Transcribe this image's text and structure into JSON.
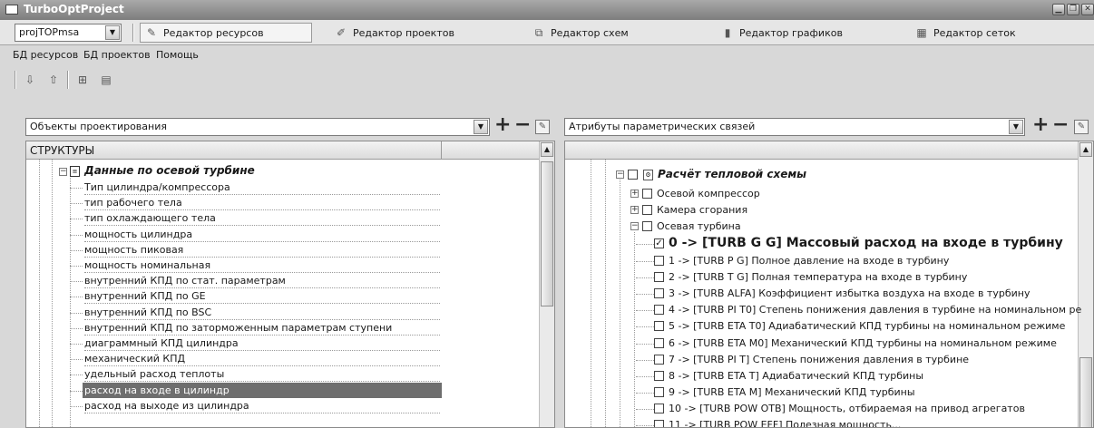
{
  "window": {
    "title": "TurboOptProject"
  },
  "toolbar": {
    "project_combo": "projTOPmsa",
    "tabs": [
      {
        "label": "Редактор ресурсов",
        "icon": "resource-editor-icon"
      },
      {
        "label": "Редактор проектов",
        "icon": "project-editor-icon"
      },
      {
        "label": "Редактор схем",
        "icon": "scheme-editor-icon"
      },
      {
        "label": "Редактор графиков",
        "icon": "chart-editor-icon"
      },
      {
        "label": "Редактор сеток",
        "icon": "grid-editor-icon"
      }
    ]
  },
  "menu": {
    "items": [
      "БД ресурсов",
      "БД проектов",
      "Помощь"
    ]
  },
  "left": {
    "combo": "Объекты проектирования",
    "header": "СТРУКТУРЫ",
    "group_title": "Данные по осевой турбине",
    "items": [
      "Тип цилиндра/компрессора",
      "тип рабочего тела",
      "тип охлаждающего тела",
      "мощность цилиндра",
      "мощность пиковая",
      "мощность номинальная",
      "внутренний КПД по стат. параметрам",
      "внутренний КПД по GE",
      "внутренний КПД по BSC",
      "внутренний КПД по заторможенным параметрам ступени",
      "диаграммный КПД цилиндра",
      "механический КПД",
      "удельный расход теплоты",
      "расход на входе в цилиндр",
      "расход на выходе из цилиндра"
    ],
    "selected_index": 13
  },
  "right": {
    "combo": "Атрибуты параметрических связей",
    "root_title": "Расчёт тепловой схемы",
    "groups": [
      "Осевой компрессор",
      "Камера сгорания",
      "Осевая турбина"
    ],
    "checked_item": "0 -> [TURB G G] Массовый расход на входе в турбину",
    "items": [
      "1 -> [TURB P G] Полное давление на входе в турбину",
      "2 -> [TURB T G] Полная температура на входе в турбину",
      "3 -> [TURB ALFA] Коэффициент избытка воздуха на входе в турбину",
      "4 -> [TURB PI T0] Степень понижения давления в турбине на номинальном ре",
      "5 -> [TURB ETA T0] Адиабатический КПД турбины на номинальном режиме",
      "6 -> [TURB ETA M0] Механический КПД турбины на номинальном режиме",
      "7 -> [TURB PI T] Степень понижения давления в турбине",
      "8 -> [TURB ETA T] Адиабатический КПД турбины",
      "9 -> [TURB ETA M] Механический КПД турбины",
      "10 -> [TURB POW OTB] Мощность, отбираемая на привод агрегатов",
      "11 -> [TURB POW EFF] Полезная мощность..."
    ]
  }
}
